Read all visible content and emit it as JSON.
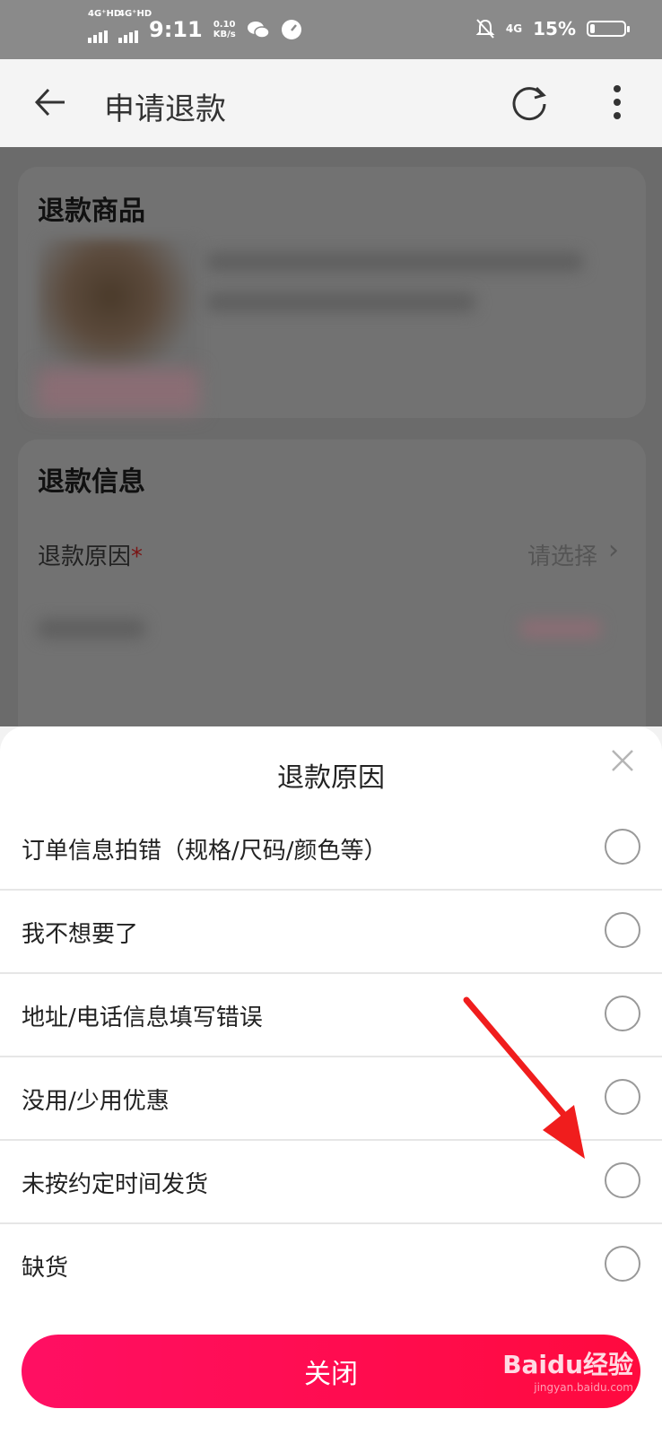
{
  "status_bar": {
    "sim1": "4G⁺HD",
    "sim2": "4G⁺HD",
    "time": "9:11",
    "speed_value": "0.10",
    "speed_unit": "KB/s",
    "net": "4G",
    "battery": "15%",
    "battery_level": 0.15
  },
  "header": {
    "title": "申请退款"
  },
  "background": {
    "product_card_title": "退款商品",
    "info_card_title": "退款信息",
    "reason_label": "退款原因",
    "required_mark": "*",
    "reason_placeholder": "请选择"
  },
  "sheet": {
    "title": "退款原因",
    "options": [
      "订单信息拍错（规格/尺码/颜色等）",
      "我不想要了",
      "地址/电话信息填写错误",
      "没用/少用优惠",
      "未按约定时间发货",
      "缺货"
    ],
    "close_button": "关闭"
  },
  "watermark": "Baidu经验",
  "watermark_sub": "jingyan.baidu.com"
}
